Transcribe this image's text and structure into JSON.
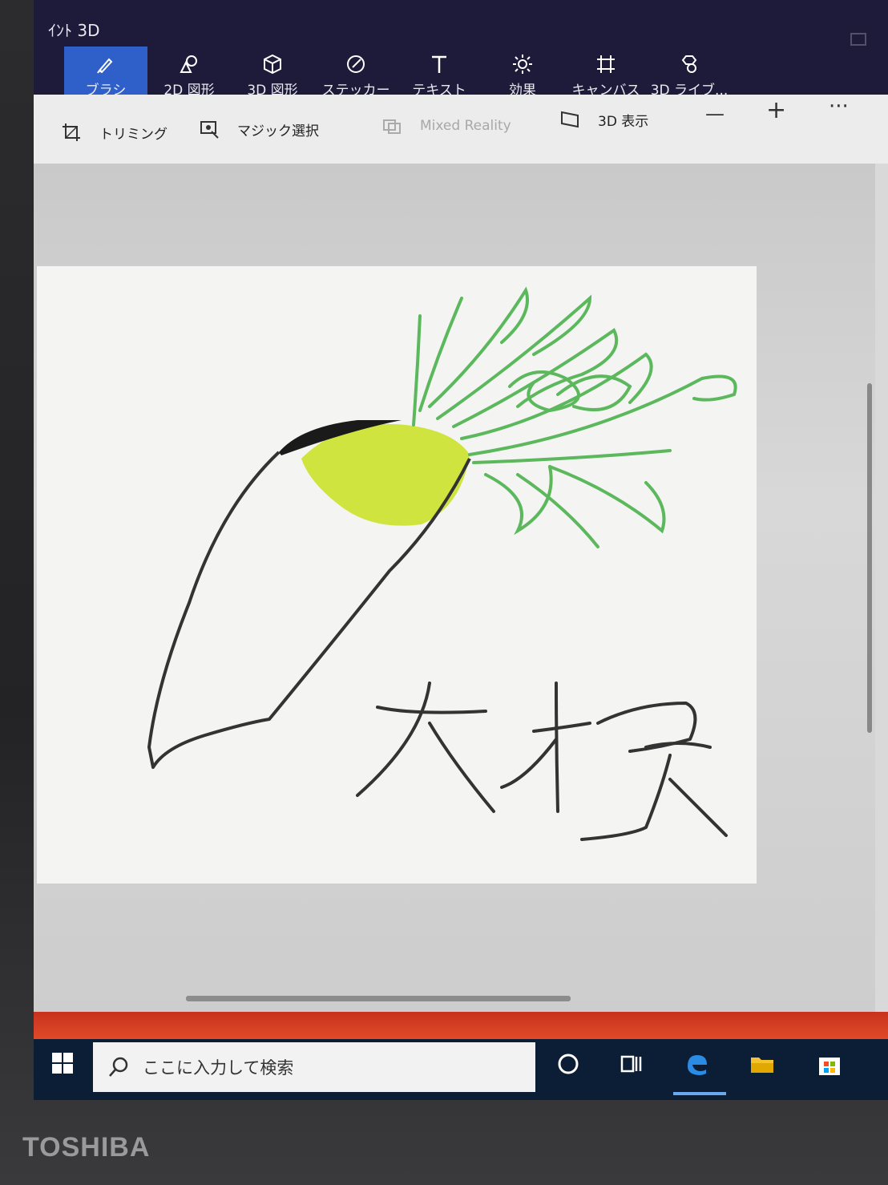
{
  "app": {
    "title": "ｲﾝﾄ 3D"
  },
  "ribbon": {
    "tools": [
      {
        "label": "ブラシ",
        "icon": "brush-icon"
      },
      {
        "label": "2D 図形",
        "icon": "2d-shapes-icon"
      },
      {
        "label": "3D 図形",
        "icon": "3d-shapes-icon"
      },
      {
        "label": "ステッカー",
        "icon": "sticker-icon"
      },
      {
        "label": "テキスト",
        "icon": "text-icon"
      },
      {
        "label": "効果",
        "icon": "effects-icon"
      },
      {
        "label": "キャンバス",
        "icon": "canvas-icon"
      },
      {
        "label": "3D ライブ...",
        "icon": "3d-library-icon"
      }
    ]
  },
  "subtoolbar": {
    "crop_label": "トリミング",
    "magic_select_label": "マジック選択",
    "mixed_reality_label": "Mixed Reality",
    "view3d_label": "3D 表示",
    "zoom_out": "—",
    "zoom_in": "+",
    "more": "···"
  },
  "canvas": {
    "handwritten_text": "大根"
  },
  "taskbar": {
    "search_placeholder": "ここに入力して検索"
  },
  "device": {
    "brand": "TOSHIBA"
  },
  "colors": {
    "ribbon_bg": "#1e1a3a",
    "active_tool": "#2f5fc8",
    "leaf_green": "#5cb85c",
    "radish_yellow": "#c8e01e",
    "taskbar_bg": "#0c1e36"
  }
}
